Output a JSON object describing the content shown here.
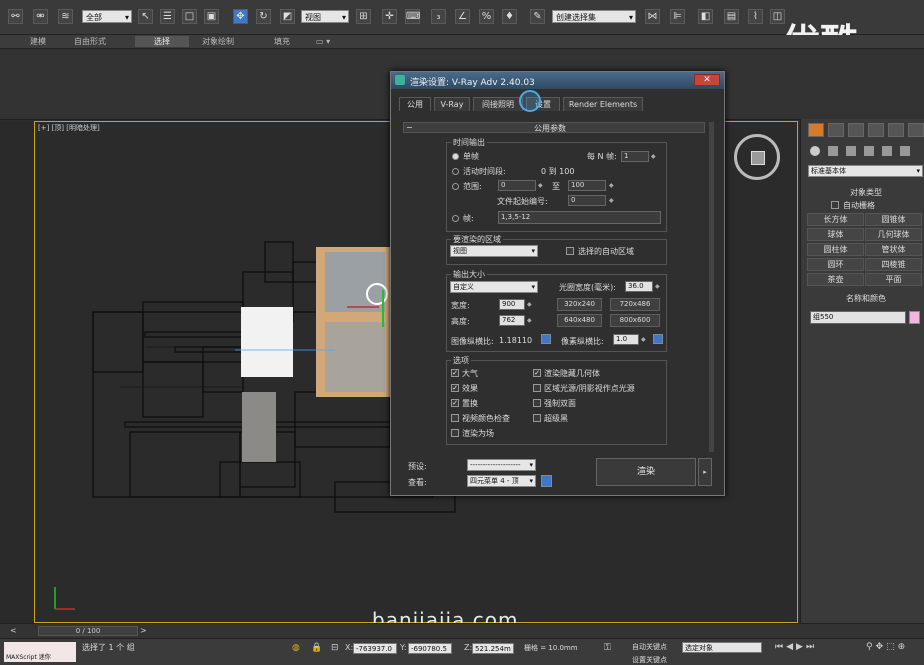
{
  "watermark": {
    "logo": "优酷",
    "site": "banjiajia.com"
  },
  "toolbar": {
    "selection_filter": "全部",
    "ref_coord": "视图",
    "named_selection": "创建选择集"
  },
  "ribbon": {
    "tabs": [
      "建模",
      "自由形式",
      "选择",
      "对象绘制",
      "填充"
    ],
    "active": "选择"
  },
  "viewport": {
    "label": "[+] [顶] [明暗处理]",
    "timeline": "0 / 100"
  },
  "dialog": {
    "title": "渲染设置: V-Ray Adv 2.40.03",
    "close": "✕",
    "tabs": [
      "公用",
      "V-Ray",
      "间接照明",
      "设置",
      "Render Elements"
    ],
    "rollout_title": "公用参数",
    "time_output": {
      "title": "时间输出",
      "single": "单帧",
      "every_n": "每 N 帧:",
      "every_n_value": "1",
      "active_segment": "活动时间段:",
      "active_range": "0 到 100",
      "range": "范围:",
      "range_from": "0",
      "range_to_label": "至",
      "range_to": "100",
      "file_number_base": "文件起始编号:",
      "file_number_value": "0",
      "frames": "帧:",
      "frames_value": "1,3,5-12"
    },
    "area": {
      "title": "要渲染的区域",
      "value": "视图",
      "auto_region": "选择的自动区域"
    },
    "output_size": {
      "title": "输出大小",
      "preset": "自定义",
      "aperture_label": "光圈宽度(毫米):",
      "aperture_value": "36.0",
      "width_label": "宽度:",
      "width_value": "900",
      "height_label": "高度:",
      "height_value": "762",
      "presets": [
        "320x240",
        "720x486",
        "640x480",
        "800x600"
      ],
      "aspect_label": "图像纵横比:",
      "aspect_value": "1.18110",
      "pixel_aspect_label": "像素纵横比:",
      "pixel_aspect_value": "1.0"
    },
    "options": {
      "title": "选项",
      "items": [
        {
          "label": "大气",
          "checked": true
        },
        {
          "label": "渲染隐藏几何体",
          "checked": true
        },
        {
          "label": "效果",
          "checked": true
        },
        {
          "label": "区域光源/阴影视作点光源",
          "checked": false
        },
        {
          "label": "置换",
          "checked": true
        },
        {
          "label": "强制双面",
          "checked": false
        },
        {
          "label": "视频颜色检查",
          "checked": false
        },
        {
          "label": "超级黑",
          "checked": false
        },
        {
          "label": "渲染为场",
          "checked": false
        }
      ]
    },
    "footer": {
      "preset_label": "预设:",
      "preset_value": "--------------------",
      "view_label": "查看:",
      "view_value": "四元菜单 4 - 顶",
      "render_button": "渲染"
    }
  },
  "cmdpanel": {
    "category": "标准基本体",
    "object_type_title": "对象类型",
    "autogrid": "自动栅格",
    "buttons": [
      "长方体",
      "圆锥体",
      "球体",
      "几何球体",
      "圆柱体",
      "管状体",
      "圆环",
      "四棱锥",
      "茶壶",
      "平面"
    ],
    "name_color_title": "名称和颜色",
    "name_value": "组550",
    "name_color": "#f0b8e0"
  },
  "status": {
    "selected": "选择了 1 个 组",
    "x_label": "X:",
    "x_value": "-763937.0",
    "y_label": "Y:",
    "y_value": "-690780.5",
    "z_label": "Z:",
    "z_value": "521.254m",
    "grid": "栅格 = 10.0mm",
    "auto_key": "自动关键点",
    "key_mode": "选定对象",
    "set_key": "设置关键点",
    "maxscript": "MAXScript 迷你"
  }
}
